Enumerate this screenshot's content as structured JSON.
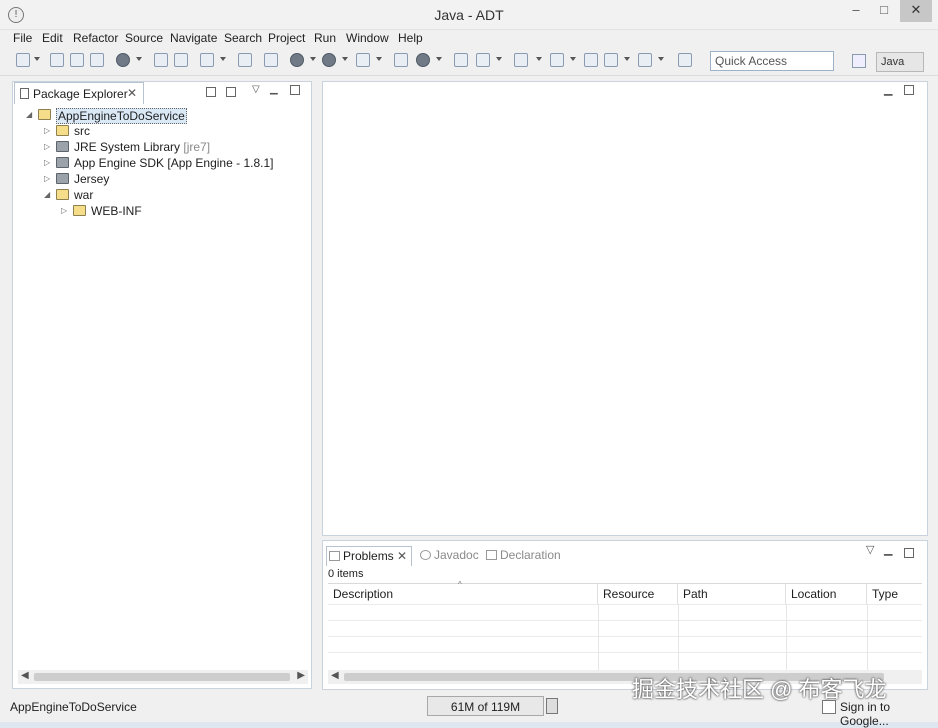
{
  "window": {
    "title": "Java - ADT",
    "min_label": "–",
    "max_label": "□",
    "close_label": "✕",
    "app_icon": "!"
  },
  "menu": [
    "File",
    "Edit",
    "Refactor",
    "Source",
    "Navigate",
    "Search",
    "Project",
    "Run",
    "Window",
    "Help"
  ],
  "quick_access": {
    "placeholder": "Quick Access"
  },
  "perspective": {
    "label": "Java"
  },
  "package_explorer": {
    "tab_label": "Package Explorer",
    "close_glyph": "✕",
    "tree": [
      {
        "label": "AppEngineToDoService",
        "decoration": "",
        "icon": "project-folder-icon",
        "expanded": true
      },
      {
        "label": "src",
        "decoration": "",
        "icon": "source-folder-icon"
      },
      {
        "label": "JRE System Library",
        "decoration": "[jre7]",
        "icon": "library-icon"
      },
      {
        "label": "App Engine SDK [App Engine - 1.8.1]",
        "decoration": "",
        "icon": "library-icon"
      },
      {
        "label": "Jersey",
        "decoration": "",
        "icon": "library-icon"
      },
      {
        "label": "war",
        "decoration": "",
        "icon": "folder-icon",
        "expanded": true
      },
      {
        "label": "WEB-INF",
        "decoration": "",
        "icon": "folder-icon"
      }
    ]
  },
  "bottom_panel": {
    "tabs": [
      {
        "label": "Problems",
        "active": true
      },
      {
        "label": "Javadoc",
        "active": false
      },
      {
        "label": "Declaration",
        "active": false
      }
    ],
    "close_glyph": "✕",
    "items_count": "0 items",
    "columns": [
      "Description",
      "Resource",
      "Path",
      "Location",
      "Type"
    ]
  },
  "status": {
    "selection": "AppEngineToDoService",
    "heap": "61M of 119M",
    "sign_in": "Sign in to Google..."
  },
  "watermark": "掘金技术社区 @ 布客飞龙"
}
